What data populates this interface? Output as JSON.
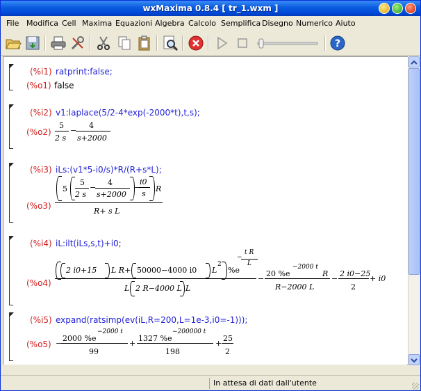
{
  "window": {
    "title": "wxMaxima 0.8.4  [ tr_1.wxm ]"
  },
  "menu": [
    "File",
    "Modifica",
    "Cell",
    "Maxima",
    "Equazioni",
    "Algebra",
    "Calcolo",
    "Semplifica",
    "Disegno",
    "Numerico",
    "Aiuto"
  ],
  "toolbar": {
    "icons": [
      "open-icon",
      "save-icon",
      "print-icon",
      "config-icon",
      "cut-icon",
      "copy-icon",
      "paste-icon",
      "find-icon",
      "interrupt-icon",
      "play-icon",
      "stop-icon",
      "slider-icon",
      "help-icon"
    ]
  },
  "cells": [
    {
      "in_label": "(%i1)",
      "input": "ratprint:false;",
      "out_label": "(%o1)",
      "output": "false"
    },
    {
      "in_label": "(%i2)",
      "input": "v1:laplace(5/2-4*exp(-2000*t),t,s);",
      "out_label": "(%o2)"
    },
    {
      "in_label": "(%i3)",
      "input": "iLs:(v1*5-i0/s)*R/(R+s*L);",
      "out_label": "(%o3)"
    },
    {
      "in_label": "(%i4)",
      "input": "iL:ilt(iLs,s,t)+i0;",
      "out_label": "(%o4)"
    },
    {
      "in_label": "(%i5)",
      "input": "expand(ratsimp(ev(iL,R=200,L=1e-3,i0=-1)));",
      "out_label": "(%o5)"
    }
  ],
  "math": {
    "o2": {
      "f1_num": "5",
      "f1_den": "2 s",
      "minus": "−",
      "f2_num": "4",
      "f2_den": "s+2000"
    },
    "o3": {
      "five": "5",
      "a_num": "5",
      "a_den": "2 s",
      "minus1": "−",
      "b_num": "4",
      "b_den": "s+2000",
      "minus2": "−",
      "c_num": "i0",
      "c_den": "s",
      "R": "R",
      "den": "R+ s L"
    },
    "o4": {
      "p1": "2 i0+15",
      "mid1": "L R+",
      "p2": "50000−4000 i0",
      "L2": "L",
      "sq": "2",
      "e_pct": "%e",
      "exp_num": "t R",
      "exp_den": "L",
      "exp_minus": "−",
      "den_L": "L",
      "den_paren": "2 R−4000 L",
      "minus_t2": "−",
      "t2_num_a": "20 %e",
      "t2_exp": "−2000 t",
      "t2_num_b": "R",
      "t2_den": "R−2000 L",
      "minus_t3": "−",
      "t3_num": "2 i0−25",
      "t3_den": "2",
      "plus_t4": "+ i0"
    },
    "o5": {
      "lead": "−",
      "a_num": "2000 %e",
      "a_exp": "−2000 t",
      "a_den": "99",
      "plus1": "+",
      "b_num": "1327 %e",
      "b_exp": "−200000 t",
      "b_den": "198",
      "plus2": "+",
      "c_num": "25",
      "c_den": "2"
    }
  },
  "status": {
    "text": "In attesa di dati dall'utente"
  }
}
